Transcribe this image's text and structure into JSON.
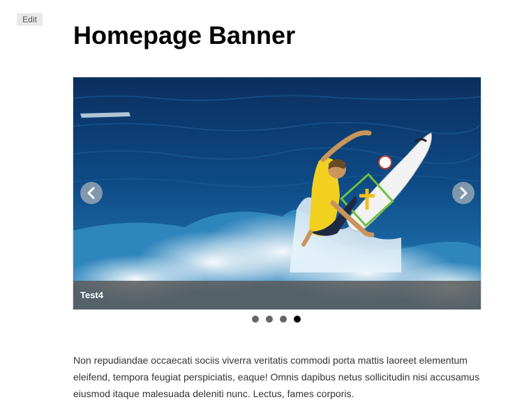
{
  "toolbar": {
    "edit_label": "Edit"
  },
  "page": {
    "title": "Homepage Banner",
    "body_text": "Non repudiandae occaecati sociis viverra veritatis commodi porta mattis laoreet elementum eleifend, tempora feugiat perspiciatis, eaque! Omnis dapibus netus sollicitudin nisi accusamus eiusmod itaque malesuada deleniti nunc. Lectus, fames corporis."
  },
  "carousel": {
    "caption": "Test4",
    "prev_icon": "chevron-left-icon",
    "next_icon": "chevron-right-icon",
    "slide_count": 4,
    "active_slide": 4
  },
  "colors": {
    "title": "#000000",
    "body_text": "#333333",
    "dot_active": "#000000",
    "dot_inactive": "#666666",
    "caption_bar": "#5a5a5a"
  }
}
